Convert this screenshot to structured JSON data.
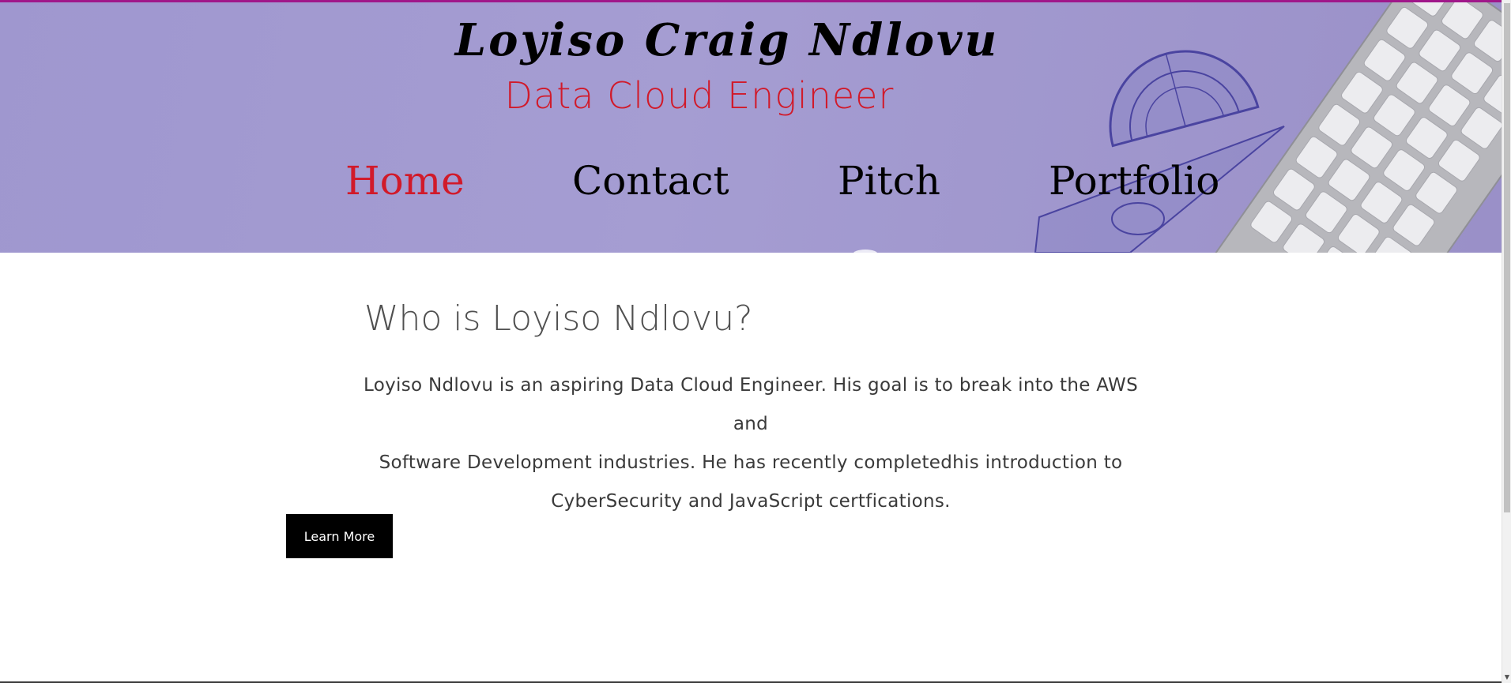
{
  "header": {
    "site_title": "Loyiso Craig Ndlovu",
    "site_subtitle": "Data Cloud Engineer",
    "nav": [
      {
        "label": "Home",
        "active": true
      },
      {
        "label": "Contact",
        "active": false
      },
      {
        "label": "Pitch",
        "active": false
      },
      {
        "label": "Portfolio",
        "active": false
      }
    ]
  },
  "main": {
    "heading": "Who is Loyiso Ndlovu?",
    "intro_lines": [
      "Loyiso Ndlovu is an aspiring Data Cloud Engineer. His goal is to break into the AWS and",
      "Software Development industries. He has recently completedhis introduction to",
      "CyberSecurity and JavaScript certfications."
    ],
    "learn_more_label": "Learn More"
  },
  "colors": {
    "accent": "#d11a2a",
    "header_background": "#a29acf",
    "button_background": "#000000"
  },
  "icons": {
    "header_art": "protractor-ruler-keyboard-image",
    "scroll_down": "chevron-down-icon"
  }
}
